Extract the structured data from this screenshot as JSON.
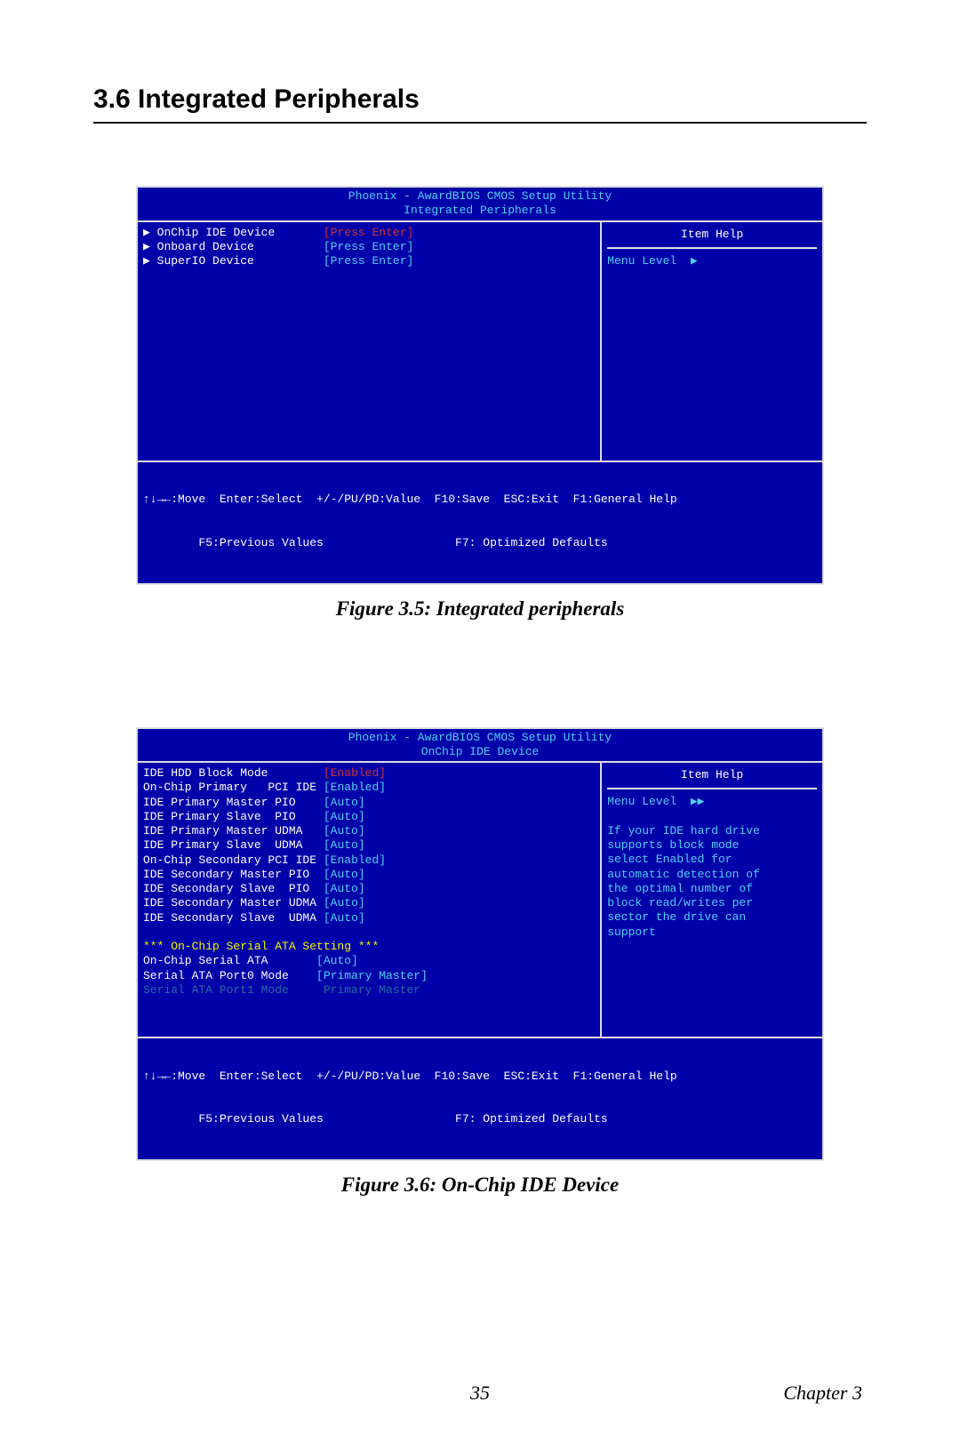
{
  "heading": "3.6  Integrated Peripherals",
  "figure1": {
    "caption": "Figure 3.5: Integrated peripherals",
    "bios": {
      "title1": "Phoenix - AwardBIOS CMOS Setup Utility",
      "title2": "Integrated Peripherals",
      "item_help": "Item Help",
      "menu_level": "Menu Level",
      "rows": [
        {
          "arrow": "▶",
          "label": "OnChip IDE Device",
          "value": "[Press Enter]",
          "selected": true
        },
        {
          "arrow": "▶",
          "label": "Onboard Device",
          "value": "[Press Enter]",
          "selected": false
        },
        {
          "arrow": "▶",
          "label": "SuperIO Device",
          "value": "[Press Enter]",
          "selected": false
        }
      ],
      "footer1": "↑↓→←:Move  Enter:Select  +/-/PU/PD:Value  F10:Save  ESC:Exit  F1:General Help",
      "footer2": "        F5:Previous Values                   F7: Optimized Defaults"
    }
  },
  "figure2": {
    "caption": "Figure 3.6: On-Chip IDE Device",
    "bios": {
      "title1": "Phoenix - AwardBIOS CMOS Setup Utility",
      "title2": "OnChip IDE Device",
      "item_help": "Item Help",
      "menu_level": "Menu Level",
      "help_text": [
        "If your IDE hard drive",
        "supports block mode",
        "select Enabled for",
        "automatic detection of",
        "the optimal number of",
        "block read/writes per",
        "sector the drive can",
        "support"
      ],
      "rows": [
        {
          "label": "IDE HDD Block Mode",
          "value": "[Enabled]",
          "selected": true
        },
        {
          "label": "On-Chip Primary   PCI IDE",
          "value": "[Enabled]"
        },
        {
          "label": "IDE Primary Master PIO",
          "value": "[Auto]"
        },
        {
          "label": "IDE Primary Slave  PIO",
          "value": "[Auto]"
        },
        {
          "label": "IDE Primary Master UDMA",
          "value": "[Auto]"
        },
        {
          "label": "IDE Primary Slave  UDMA",
          "value": "[Auto]"
        },
        {
          "label": "On-Chip Secondary PCI IDE",
          "value": "[Enabled]"
        },
        {
          "label": "IDE Secondary Master PIO",
          "value": "[Auto]"
        },
        {
          "label": "IDE Secondary Slave  PIO",
          "value": "[Auto]"
        },
        {
          "label": "IDE Secondary Master UDMA",
          "value": "[Auto]"
        },
        {
          "label": "IDE Secondary Slave  UDMA",
          "value": "[Auto]"
        }
      ],
      "sata_heading": "*** On-Chip Serial ATA Setting ***",
      "sata_rows": [
        {
          "label": "On-Chip Serial ATA",
          "value": "[Auto]",
          "dim": false
        },
        {
          "label": "Serial ATA Port0 Mode",
          "value": "[Primary Master]",
          "dim": false
        },
        {
          "label": "Serial ATA Port1 Mode",
          "value": " Primary Master",
          "dim": true
        }
      ],
      "footer1": "↑↓→←:Move  Enter:Select  +/-/PU/PD:Value  F10:Save  ESC:Exit  F1:General Help",
      "footer2": "        F5:Previous Values                   F7: Optimized Defaults"
    }
  },
  "footer": {
    "page": "35",
    "chapter": "Chapter 3"
  }
}
